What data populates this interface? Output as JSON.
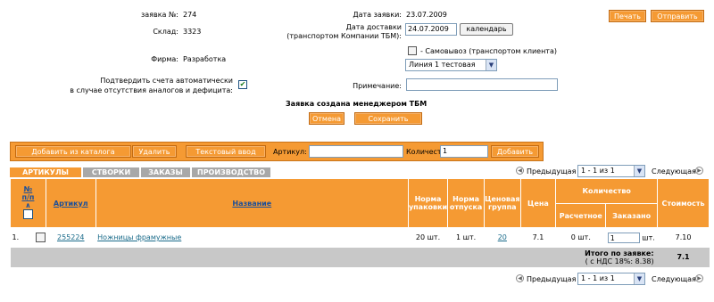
{
  "form": {
    "order_no_label": "заявка №:",
    "order_no": "274",
    "warehouse_label": "Склад:",
    "warehouse": "3323",
    "firm_label": "Фирма:",
    "firm": "Разработка",
    "auto_confirm_label_1": "Подтвердить счета автоматически",
    "auto_confirm_label_2": "в случае отсутствия аналогов и дефицита:",
    "auto_confirm_checked": true,
    "order_date_label": "Дата заявки:",
    "order_date": "23.07.2009",
    "delivery_date_label_1": "Дата доставки",
    "delivery_date_label_2": "(транспортом Компании ТБМ):",
    "delivery_date": "24.07.2009",
    "calendar_button": "календарь",
    "self_pickup_label": "- Самовывоз (транспортом клиента)",
    "self_pickup_checked": false,
    "line_select": "Линия 1 тестовая",
    "note_label": "Примечание:",
    "note_value": "",
    "status_text": "Заявка создана менеджером ТБМ",
    "cancel_button": "Отмена",
    "save_button": "Сохранить",
    "print_button": "Печать",
    "send_button": "Отправить"
  },
  "toolbar": {
    "add_from_catalog": "Добавить из каталога",
    "delete": "Удалить",
    "text_input": "Текстовый ввод",
    "article_label": "Артикул:",
    "article_value": "",
    "quantity_label": "Количество:",
    "quantity_value": "1",
    "add": "Добавить"
  },
  "tabs": [
    "АРТИКУЛЫ",
    "СТВОРКИ",
    "ЗАКАЗЫ",
    "ПРОИЗВОДСТВО"
  ],
  "pager": {
    "prev": "Предыдущая",
    "range": "1 - 1 из 1",
    "next": "Следующая"
  },
  "table": {
    "headers": {
      "num": "№",
      "num_sub": "п/п",
      "num_sort": "∧",
      "article": "Артикул",
      "name": "Название",
      "pack_norm_1": "Норма",
      "pack_norm_2": "упаковки",
      "release_norm_1": "Норма",
      "release_norm_2": "отпуска",
      "price_group_1": "Ценовая",
      "price_group_2": "группа",
      "price": "Цена",
      "quantity": "Количество",
      "qty_calc": "Расчетное",
      "qty_ordered": "Заказано",
      "cost": "Стоимость"
    },
    "rows": [
      {
        "num": "1.",
        "article": "255224",
        "name": "Ножницы фрамужные",
        "pack_norm": "20 шт.",
        "release_norm": "1 шт.",
        "price_group": "20",
        "price": "7.1",
        "qty_calc": "0 шт.",
        "qty_ordered": "1",
        "qty_unit": "шт.",
        "cost": "7.10"
      }
    ],
    "total_label": "Итого по заявке:",
    "total_vat": "( с НДС 18%: 8.38)",
    "total_value": "7.1"
  }
}
